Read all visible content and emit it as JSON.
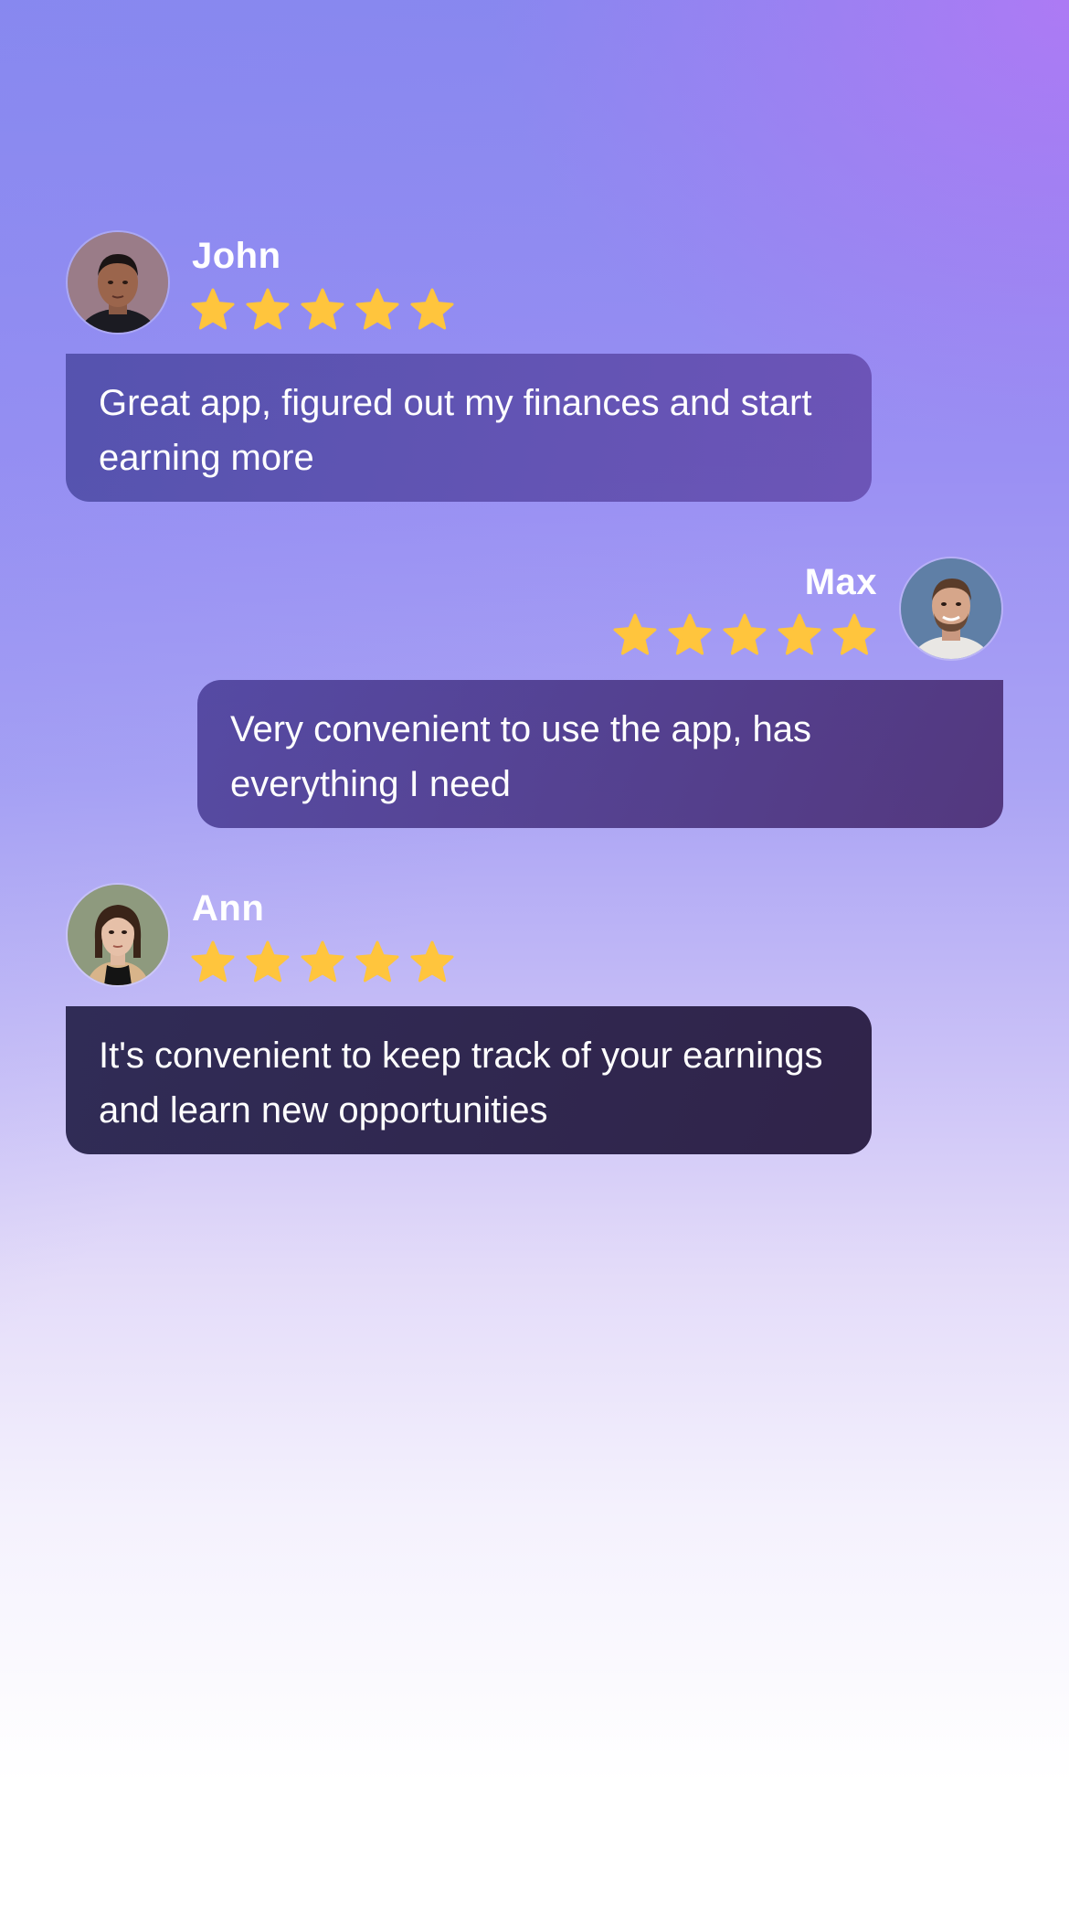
{
  "colors": {
    "star": "#FFC53D",
    "text": "#FFFFFF",
    "background_top": "#8A86EF",
    "background_bottom": "#FFFFFF"
  },
  "reviews": [
    {
      "name": "John",
      "rating": 5,
      "max_rating": 5,
      "text": "Great app, figured out my finances and start earning more",
      "avatar_icon": "avatar-photo-john",
      "align": "left"
    },
    {
      "name": "Max",
      "rating": 5,
      "max_rating": 5,
      "text": "Very convenient to use the app, has everything I need",
      "avatar_icon": "avatar-photo-max",
      "align": "right"
    },
    {
      "name": "Ann",
      "rating": 5,
      "max_rating": 5,
      "text": "It's convenient to keep track of your earnings and learn new opportunities",
      "avatar_icon": "avatar-photo-ann",
      "align": "left"
    }
  ]
}
